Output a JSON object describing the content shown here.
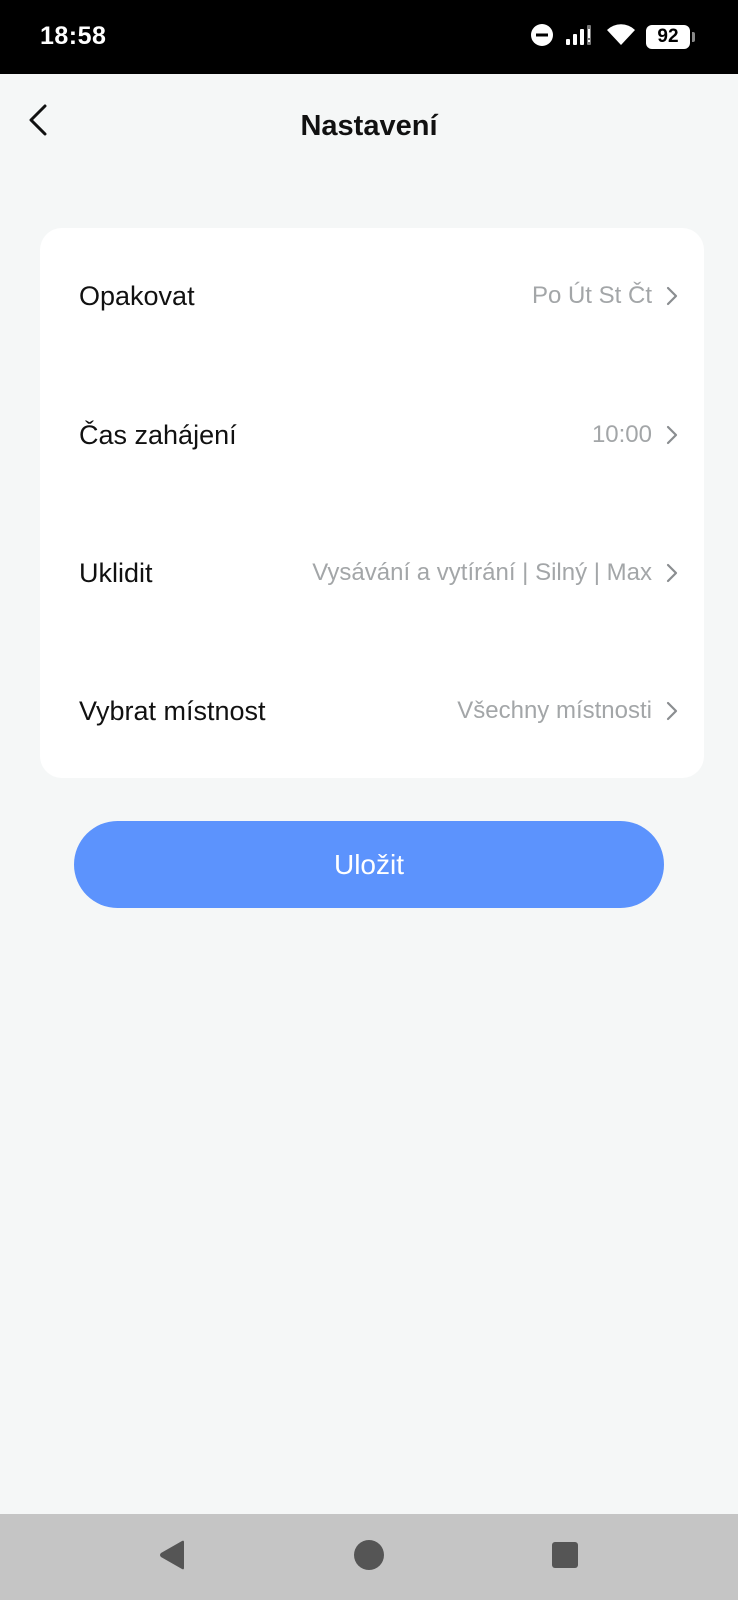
{
  "status_bar": {
    "time": "18:58",
    "battery": "92",
    "icons": [
      "do-not-disturb-icon",
      "signal-icon",
      "wifi-icon",
      "battery-icon"
    ]
  },
  "header": {
    "title": "Nastavení",
    "back_icon": "chevron-left-icon"
  },
  "settings": {
    "rows": [
      {
        "label": "Opakovat",
        "value": "Po Út St Čt"
      },
      {
        "label": "Čas zahájení",
        "value": "10:00"
      },
      {
        "label": "Uklidit",
        "value": "Vysávání a vytírání | Silný | Max"
      },
      {
        "label": "Vybrat místnost",
        "value": "Všechny místnosti"
      }
    ]
  },
  "save_button": {
    "label": "Uložit"
  },
  "colors": {
    "accent": "#5c93fd",
    "background": "#f5f7f7",
    "value_text": "#a3a6a8"
  },
  "nav_bar": {
    "icons": [
      "back-triangle-icon",
      "home-circle-icon",
      "recents-square-icon"
    ]
  }
}
